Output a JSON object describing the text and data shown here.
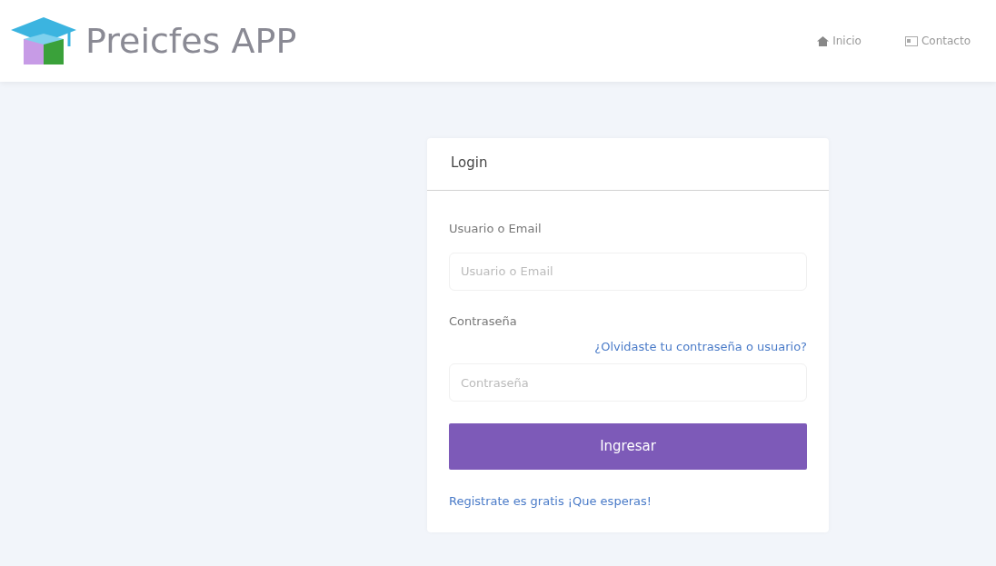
{
  "brand": {
    "name": "Preicfes APP"
  },
  "nav": [
    {
      "kind": "home",
      "label": "Inicio"
    },
    {
      "kind": "contact",
      "label": "Contacto"
    }
  ],
  "login": {
    "title": "Login",
    "user_label": "Usuario o Email",
    "user_field": {
      "placeholder": "Usuario o Email"
    },
    "password_label": "Contraseña",
    "forgot_link": "¿Olvidaste tu contraseña o usuario?",
    "password_field": {
      "placeholder": "Contraseña"
    },
    "submit": "Ingresar",
    "register_link": "Registrate es gratis ¡Que esperas!"
  }
}
